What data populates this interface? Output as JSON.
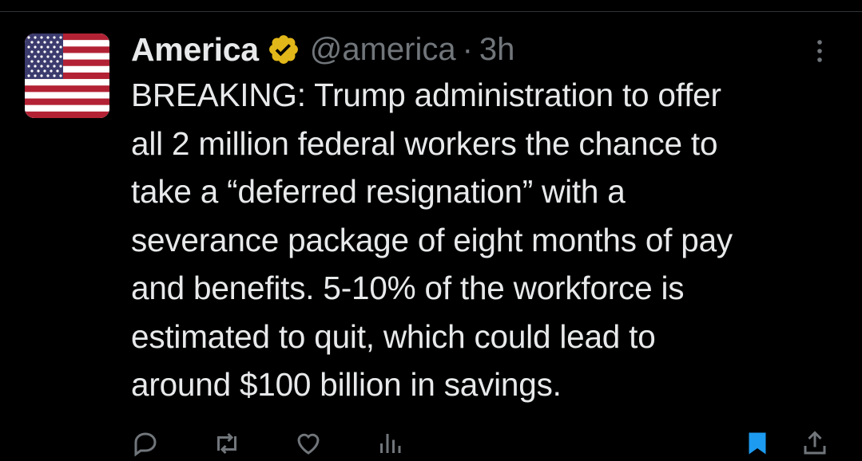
{
  "tweet": {
    "author": {
      "display_name": "America",
      "handle": "@america",
      "verified_badge": "gold-verified-badge-icon",
      "avatar": "us-flag-avatar"
    },
    "separator": "·",
    "time": "3h",
    "text": "BREAKING: Trump administration to offer\nall 2 million federal workers the chance to\ntake a “deferred resignation” with a\nseverance package of eight months of pay\nand benefits. 5-10% of the workforce is\nestimated to quit, which could lead to\naround $100 billion in savings.",
    "more_menu_icon": "more-vertical-icon"
  },
  "actions": {
    "reply": {
      "icon": "reply-icon",
      "count": ""
    },
    "repost": {
      "icon": "repost-icon",
      "count": ""
    },
    "like": {
      "icon": "heart-icon",
      "count": ""
    },
    "views": {
      "icon": "views-icon",
      "count": ""
    },
    "bookmark": {
      "icon": "bookmark-icon"
    },
    "share": {
      "icon": "share-icon"
    }
  },
  "colors": {
    "background": "#000000",
    "text_primary": "#e7e9ea",
    "text_secondary": "#71767b",
    "verified_gold": "#e2b719",
    "bookmark_blue": "#1d9bf0"
  }
}
